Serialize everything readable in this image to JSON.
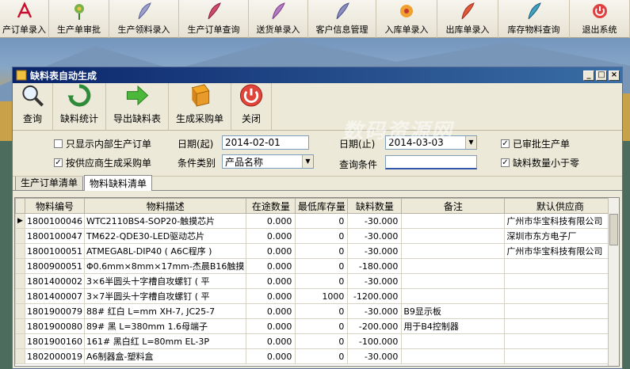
{
  "main_toolbar": {
    "items": [
      {
        "label": "产订单录入",
        "icon": "pdf-icon"
      },
      {
        "label": "生产单审批",
        "icon": "flower-icon"
      },
      {
        "label": "生产领料录入",
        "icon": "feather-icon"
      },
      {
        "label": "生产订单查询",
        "icon": "feather-icon"
      },
      {
        "label": "送货单录入",
        "icon": "flower-icon"
      },
      {
        "label": "客户信息管理",
        "icon": "feather-icon"
      },
      {
        "label": "入库单录入",
        "icon": "flower-icon"
      },
      {
        "label": "出库单录入",
        "icon": "feather-icon"
      },
      {
        "label": "库存物料查询",
        "icon": "feather-icon"
      },
      {
        "label": "退出系统",
        "icon": "exit-icon"
      }
    ]
  },
  "window": {
    "title": "缺料表自动生成",
    "buttons": {
      "minimize": "_",
      "maximize": "□",
      "close": "×"
    }
  },
  "window_toolbar": {
    "items": [
      {
        "label": "查询",
        "icon": "magnifier-icon"
      },
      {
        "label": "缺料统计",
        "icon": "recycle-icon"
      },
      {
        "label": "导出缺料表",
        "icon": "arrow-right-icon"
      },
      {
        "label": "生成采购单",
        "icon": "book-icon"
      },
      {
        "label": "关闭",
        "icon": "power-icon"
      }
    ]
  },
  "filters": {
    "only_internal": "只显示内部生产订单",
    "by_supplier": "按供应商生成采购单",
    "date_from_label": "日期(起)",
    "date_from": "2014-02-01",
    "date_to_label": "日期(止)",
    "date_to": "2014-03-03",
    "category_label": "条件类别",
    "category_value": "产品名称",
    "condition_label": "查询条件",
    "condition_value": "",
    "approved": "已审批生产单",
    "shortage_lt_zero": "缺料数量小于零"
  },
  "tabs": [
    "生产订单清单",
    "物料缺料清单"
  ],
  "grid": {
    "headers": [
      "物料编号",
      "物料描述",
      "在途数量",
      "最低库存量",
      "缺料数量",
      "备注",
      "默认供应商"
    ],
    "rows": [
      [
        "1800100046",
        "WTC2110BS4-SOP20-触摸芯片",
        "0.000",
        "0",
        "-30.000",
        "",
        "广州市华宝科技有限公司"
      ],
      [
        "1800100047",
        "TM622-QDE30-LED驱动芯片",
        "0.000",
        "0",
        "-30.000",
        "",
        "深圳市东方电子厂"
      ],
      [
        "1800100051",
        "ATMEGA8L-DIP40 ( A6C程序 )",
        "0.000",
        "0",
        "-30.000",
        "",
        "广州市华宝科技有限公司"
      ],
      [
        "1800900051",
        "Φ0.6mm×8mm×17mm-杰晨B16触摸",
        "0.000",
        "0",
        "-180.000",
        "",
        ""
      ],
      [
        "1801400002",
        "3×6半圆头十字槽自攻螺钉 ( 平",
        "0.000",
        "0",
        "-30.000",
        "",
        ""
      ],
      [
        "1801400007",
        "3×7半圆头十字槽自攻螺钉 ( 平",
        "0.000",
        "1000",
        "-1200.000",
        "",
        ""
      ],
      [
        "1801900079",
        "88#  红白 L=mm XH-7, JC25-7",
        "0.000",
        "0",
        "-30.000",
        "B9显示板",
        ""
      ],
      [
        "1801900080",
        "89#  黑 L=380mm 1.6母端子",
        "0.000",
        "0",
        "-200.000",
        "用于B4控制器",
        ""
      ],
      [
        "1801900160",
        "161#  黑白红 L=80mm EL-3P",
        "0.000",
        "0",
        "-100.000",
        "",
        ""
      ],
      [
        "1802000019",
        "A6制器盒-塑料盒",
        "0.000",
        "0",
        "-30.000",
        "",
        ""
      ]
    ]
  },
  "watermark": "数码资源网",
  "colors": {
    "title_bar": "#0a246a",
    "window_bg": "#ece9d8"
  }
}
